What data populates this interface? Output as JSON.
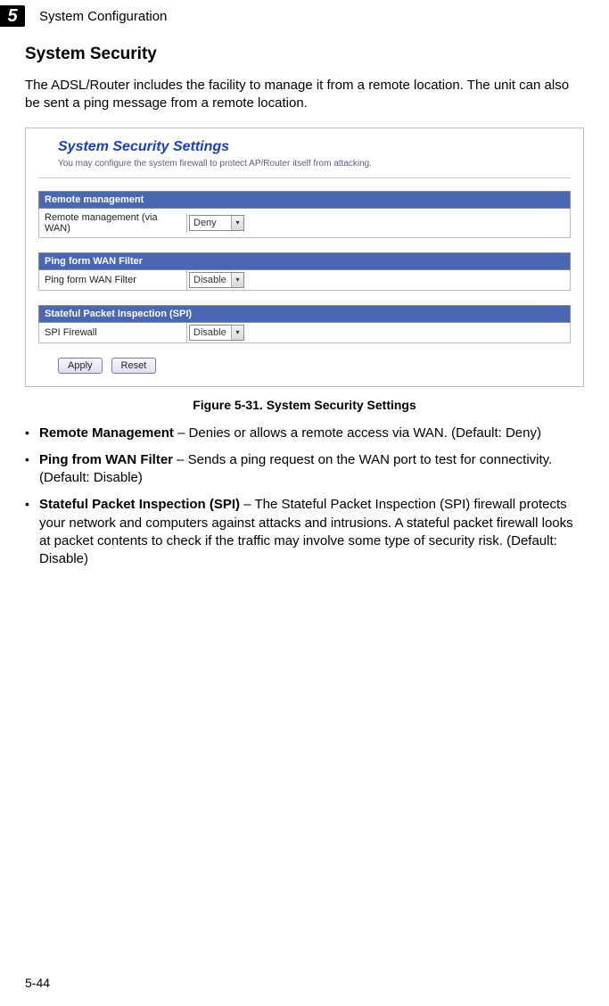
{
  "chapter": {
    "number": "5",
    "title": "System Configuration"
  },
  "heading": "System Security",
  "intro": "The ADSL/Router includes the facility to manage it from a remote location. The unit can also be sent a ping message from a remote location.",
  "screenshot": {
    "title": "System Security Settings",
    "desc": "You may configure the system firewall to protect AP/Router itself from attacking.",
    "groups": [
      {
        "header": "Remote management",
        "field_label": "Remote management (via WAN)",
        "value": "Deny"
      },
      {
        "header": "Ping form WAN Filter",
        "field_label": "Ping form WAN Filter",
        "value": "Disable"
      },
      {
        "header": "Stateful Packet Inspection (SPI)",
        "field_label": "SPI Firewall",
        "value": "Disable"
      }
    ],
    "buttons": {
      "apply": "Apply",
      "reset": "Reset"
    }
  },
  "caption": "Figure 5-31.   System Security Settings",
  "bullets": [
    {
      "term": "Remote Management",
      "rest": " – Denies or allows a remote access via WAN. (Default: Deny)"
    },
    {
      "term": "Ping from WAN Filter",
      "rest": " – Sends a ping request on the WAN port to test for connectivity. (Default: Disable)"
    },
    {
      "term": "Stateful Packet Inspection (SPI)",
      "rest": " – The Stateful Packet Inspection (SPI) firewall protects your network and computers against attacks and intrusions. A stateful packet firewall looks at packet contents to check if the traffic may involve some type of security risk. (Default: Disable)"
    }
  ],
  "page_num": "5-44"
}
